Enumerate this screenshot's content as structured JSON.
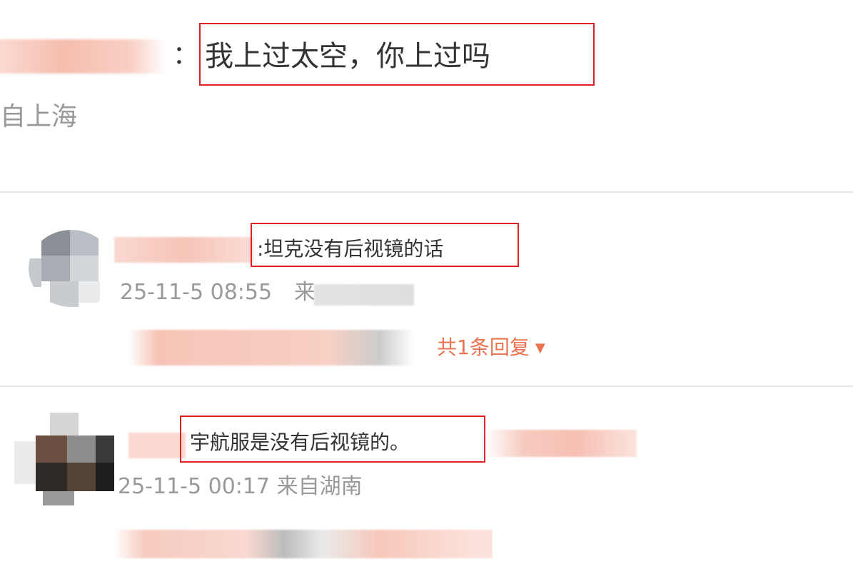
{
  "top_comment": {
    "colon": "：",
    "text": "我上过太空，你上过吗",
    "location": "自上海"
  },
  "comments": [
    {
      "text": ":坦克没有后视镜的话",
      "meta_time": "25-11-5 08:55",
      "meta_from": "来",
      "replies_label": "共1条回复",
      "replies_caret": "▼"
    },
    {
      "text": "宇航服是没有后视镜的。",
      "meta": "25-11-5 00:17 来自湖南"
    }
  ],
  "colors": {
    "link": "#eb7350",
    "highlight_box": "#e02020",
    "meta_gray": "#999999",
    "divider": "#e6e6e6"
  }
}
